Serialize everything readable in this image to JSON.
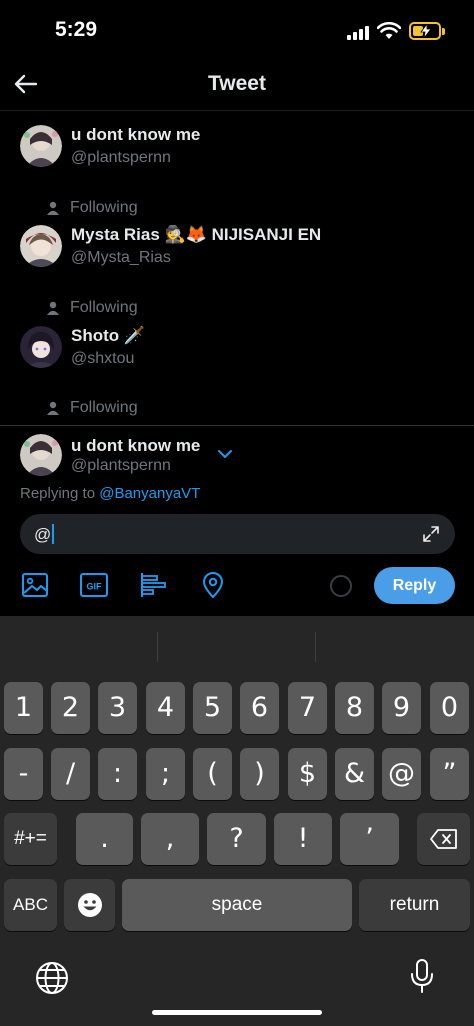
{
  "status_bar": {
    "time": "5:29"
  },
  "header": {
    "title": "Tweet"
  },
  "list": [
    {
      "name": "u dont know me",
      "handle": "@plantspernn",
      "following": ""
    },
    {
      "name": "Mysta Rias 🕵🦊 NIJISANJI EN",
      "handle": "@Mysta_Rias",
      "following": "Following"
    },
    {
      "name": "Shoto 🗡️",
      "handle": "@shxtou",
      "following": "Following"
    },
    {
      "name": "",
      "handle": "",
      "following": "Following"
    }
  ],
  "compose": {
    "account_name": "u dont know me",
    "account_handle": "@plantspernn",
    "replying_prefix": "Replying to",
    "replying_to": "@BanyanyaVT",
    "input_value": "@",
    "reply_label": "Reply"
  },
  "keyboard": {
    "row1": [
      "1",
      "2",
      "3",
      "4",
      "5",
      "6",
      "7",
      "8",
      "9",
      "0"
    ],
    "row2": [
      "-",
      "/",
      ":",
      ";",
      "(",
      ")",
      "$",
      "&",
      "@",
      "”"
    ],
    "row3_shift": "#+=",
    "row3": [
      ".",
      ",",
      "?",
      "!",
      "’"
    ],
    "abc": "ABC",
    "space": "space",
    "return": "return"
  },
  "colors": {
    "accent": "#1d9bf0",
    "reply_button": "#4a9ee8",
    "muted": "#71767b"
  }
}
